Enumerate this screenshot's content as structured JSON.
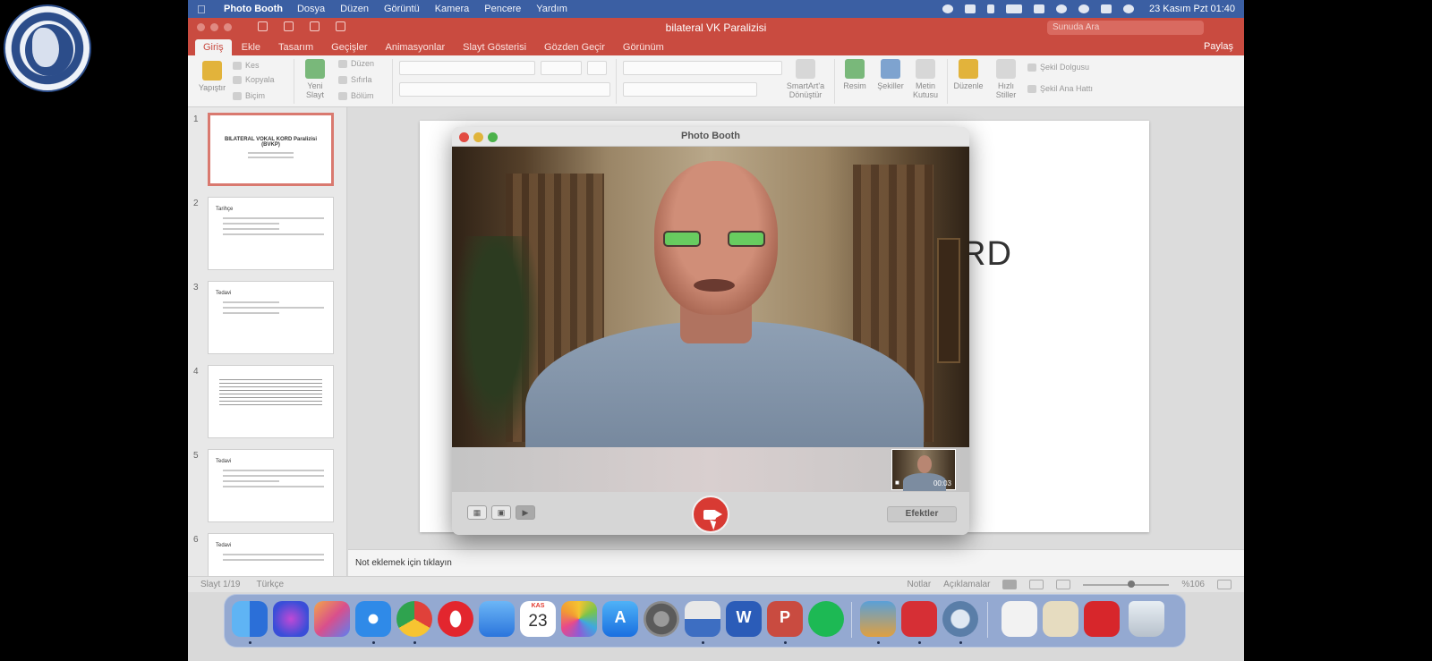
{
  "menubar": {
    "app_name": "Photo Booth",
    "items": [
      "Dosya",
      "Düzen",
      "Görüntü",
      "Kamera",
      "Pencere",
      "Yardım"
    ],
    "clock": "23 Kasım Pzt 01:40"
  },
  "ppt": {
    "title": "bilateral VK Paralizisi",
    "search_placeholder": "Sunuda Ara",
    "tabs": [
      "Giriş",
      "Ekle",
      "Tasarım",
      "Geçişler",
      "Animasyonlar",
      "Slayt Gösterisi",
      "Gözden Geçir",
      "Görünüm"
    ],
    "share_label": "Paylaş",
    "ribbon": {
      "paste": "Yapıştır",
      "cut": "Kes",
      "copy": "Kopyala",
      "format": "Biçim",
      "new_slide_line1": "Yeni",
      "new_slide_line2": "Slayt",
      "layout": "Düzen",
      "reset": "Sıfırla",
      "section": "Bölüm",
      "smartart_line1": "SmartArt'a",
      "smartart_line2": "Dönüştür",
      "picture": "Resim",
      "shapes": "Şekiller",
      "textbox_line1": "Metin",
      "textbox_line2": "Kutusu",
      "arrange": "Düzenle",
      "quick_styles_line1": "Hızlı",
      "quick_styles_line2": "Stiller",
      "shape_fill": "Şekil Dolgusu",
      "shape_outline": "Şekil Ana Hattı"
    },
    "thumbnails": [
      {
        "number": "1",
        "title": "BILATERAL VOKAL KORD Paralizisi (BVKP)"
      },
      {
        "number": "2",
        "title": "Tarihçe"
      },
      {
        "number": "3",
        "title": "Tedavi"
      },
      {
        "number": "4",
        "title": ""
      },
      {
        "number": "5",
        "title": "Tedavi"
      },
      {
        "number": "6",
        "title": "Tedavi"
      }
    ],
    "slide_title_fragment": "RD",
    "notes_placeholder": "Not eklemek için tıklayın",
    "status": {
      "slide_counter": "Slayt 1/19",
      "language": "Türkçe",
      "notes": "Notlar",
      "comments": "Açıklamalar",
      "zoom": "%106"
    }
  },
  "photobooth": {
    "window_title": "Photo Booth",
    "thumbnail_time": "00:03",
    "effects_label": "Efektler"
  },
  "dock": {
    "calendar_month": "KAS",
    "calendar_day": "23",
    "word_glyph": "W",
    "powerpoint_glyph": "P"
  },
  "colors": {
    "ppt_accent": "#c94b40",
    "menubar": "#3b5fa3",
    "record_button": "#d83a33"
  }
}
